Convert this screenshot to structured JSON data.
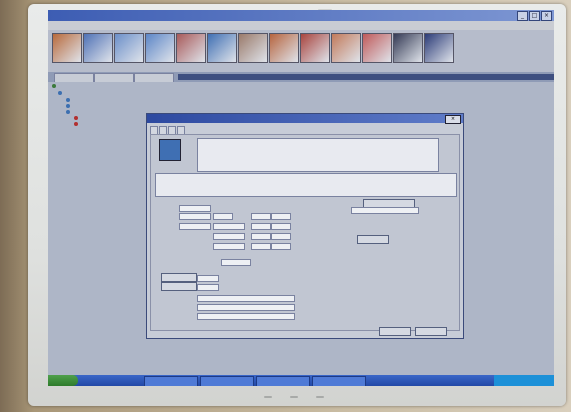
{
  "window": {
    "title": ""
  },
  "menu": {
    "items": [
      "",
      "",
      "",
      "",
      "",
      "",
      "",
      ""
    ]
  },
  "toolbar": {
    "buttons": [
      {
        "label": "",
        "color": "#b86a3c"
      },
      {
        "label": "",
        "color": "#4f72b6"
      },
      {
        "label": "",
        "color": "#6b8fc9"
      },
      {
        "label": "",
        "color": "#5c86c7"
      },
      {
        "label": "",
        "color": "#a85a5a"
      },
      {
        "label": "",
        "color": "#3f6fb3"
      },
      {
        "label": "",
        "color": "#9a7a6a"
      },
      {
        "label": "",
        "color": "#b6643e"
      },
      {
        "label": "",
        "color": "#a8443e"
      },
      {
        "label": "",
        "color": "#c27a5a"
      },
      {
        "label": "",
        "color": "#c05a5a"
      },
      {
        "label": "",
        "color": "#343a55"
      },
      {
        "label": "",
        "color": "#2b3b78"
      }
    ]
  },
  "tabs": [
    {
      "label": ""
    },
    {
      "label": ""
    },
    {
      "label": ""
    }
  ],
  "tree": {
    "nodes": [
      "",
      "",
      "",
      "",
      "",
      "",
      ""
    ]
  },
  "dialog": {
    "title": "",
    "tabs": [
      "",
      "",
      "",
      ""
    ],
    "header_text": "",
    "icon_caption": "",
    "buttons": {
      "ok": "",
      "cancel": ""
    }
  },
  "taskbar": {
    "start_label": "",
    "items": [
      "",
      "",
      "",
      ""
    ],
    "clock": ""
  },
  "monitor": {
    "model": ""
  }
}
